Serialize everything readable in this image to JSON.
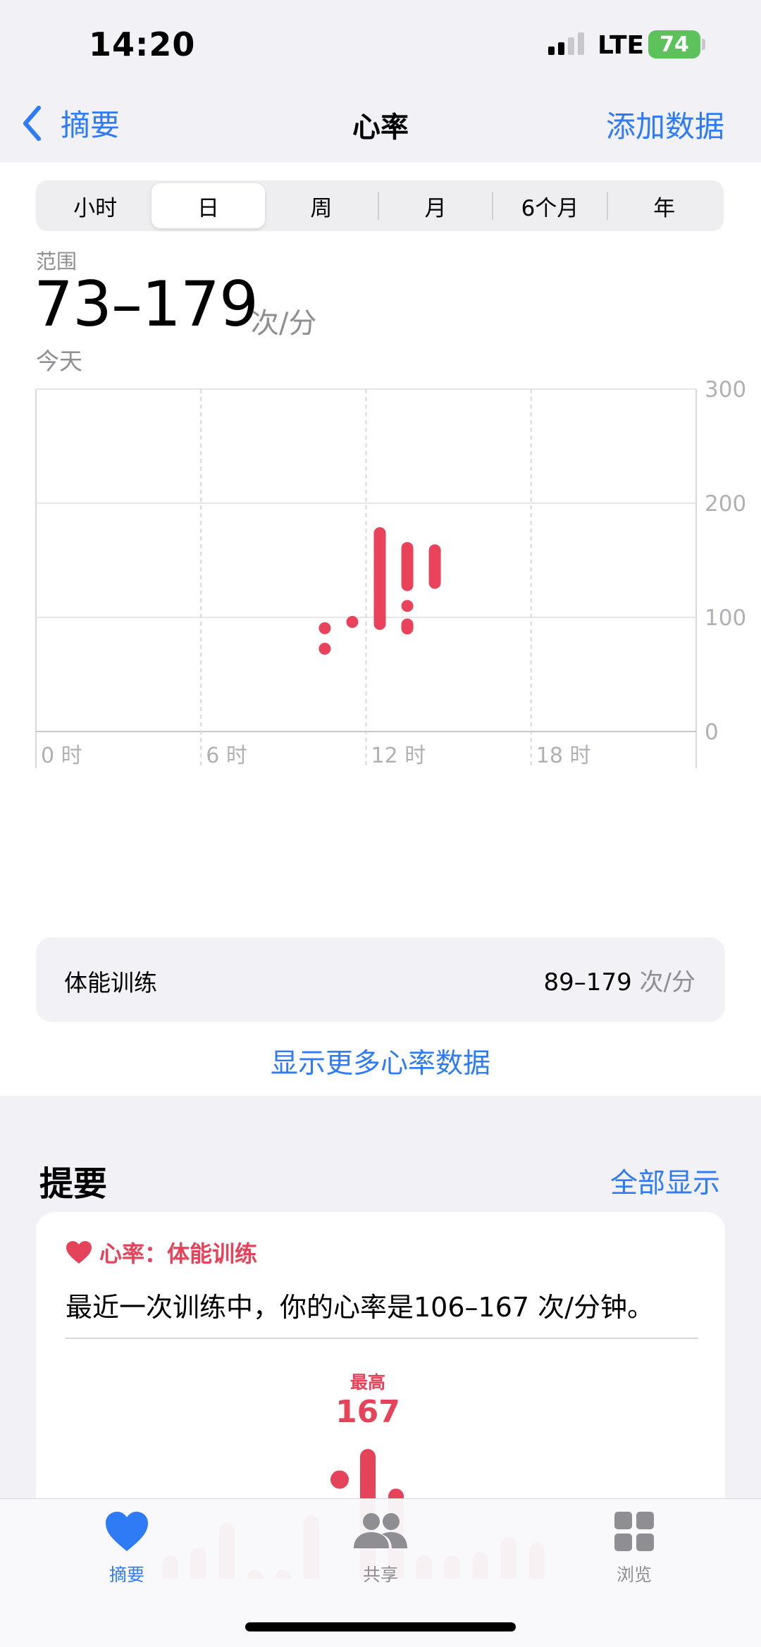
{
  "status": {
    "time": "14:20",
    "network": "LTE",
    "battery": "74"
  },
  "nav": {
    "back_label": "摘要",
    "title": "心率",
    "action_label": "添加数据"
  },
  "segments": [
    "小时",
    "日",
    "周",
    "月",
    "6个月",
    "年"
  ],
  "selected_segment": "日",
  "summary": {
    "range_label": "范围",
    "range_value": "73–179",
    "unit": "次/分",
    "date_label": "今天"
  },
  "chart_data": {
    "type": "range-bar",
    "y_ticks": [
      "300",
      "200",
      "100",
      "0"
    ],
    "ylim": [
      0,
      300
    ],
    "x_ticks": [
      "0 时",
      "6 时",
      "12 时",
      "18 时"
    ],
    "xlim": [
      0,
      24
    ],
    "grid": true,
    "color": "#e8435a",
    "ranges": [
      {
        "hour": 10.5,
        "min": 71,
        "max": 74
      },
      {
        "hour": 10.5,
        "min": 89,
        "max": 92
      },
      {
        "hour": 11.5,
        "min": 91,
        "max": 101
      },
      {
        "hour": 12.5,
        "min": 89,
        "max": 179
      },
      {
        "hour": 13.5,
        "min": 85,
        "max": 99
      },
      {
        "hour": 13.5,
        "min": 105,
        "max": 115
      },
      {
        "hour": 13.5,
        "min": 123,
        "max": 166
      },
      {
        "hour": 14.5,
        "min": 125,
        "max": 164
      }
    ]
  },
  "workout": {
    "label": "体能训练",
    "value": "89–179",
    "unit": "次/分"
  },
  "show_more_label": "显示更多心率数据",
  "highlights": {
    "title": "提要",
    "show_all_label": "全部显示",
    "card": {
      "heading": "心率：体能训练",
      "text": "最近一次训练中，你的心率是106–167 次/分钟。",
      "max_label": "最高",
      "max_value": "167",
      "bars": [
        108,
        112,
        126,
        100,
        100,
        130,
        150,
        167,
        145,
        108,
        108,
        110,
        118,
        115
      ],
      "highlight_dot_index": 6
    }
  },
  "tabbar": {
    "tabs": [
      {
        "label": "摘要"
      },
      {
        "label": "共享"
      },
      {
        "label": "浏览"
      }
    ]
  },
  "colors": {
    "accent": "#2f7bf6",
    "heart": "#e5435a",
    "battery": "#5ec25c"
  }
}
